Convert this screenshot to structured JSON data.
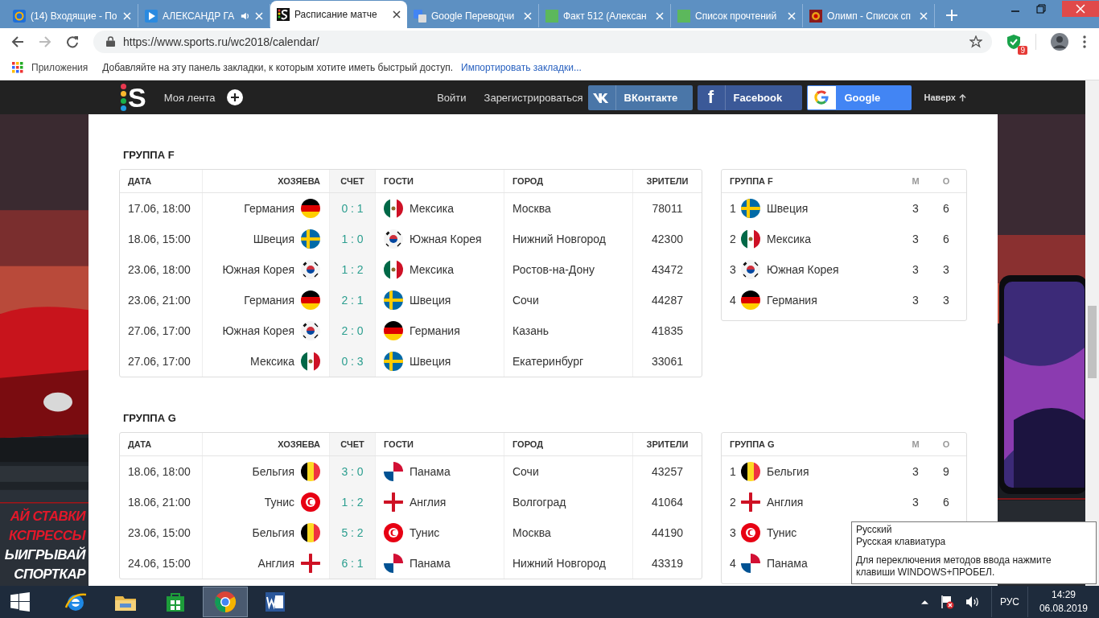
{
  "browser": {
    "tabs": [
      {
        "title": "(14) Входящие - По",
        "kind": "mail",
        "audio": false,
        "selected": false
      },
      {
        "title": "АЛЕКСАНДР ГА",
        "kind": "video",
        "audio": true,
        "selected": false
      },
      {
        "title": "Расписание матче",
        "kind": "sports",
        "audio": false,
        "selected": true
      },
      {
        "title": "Google Переводчи",
        "kind": "translate",
        "audio": false,
        "selected": false
      },
      {
        "title": "Факт 512 (Алексан",
        "kind": "sheet",
        "audio": false,
        "selected": false
      },
      {
        "title": "Список прочтений",
        "kind": "sheet",
        "audio": false,
        "selected": false
      },
      {
        "title": "Олимп - Список сп",
        "kind": "emblem",
        "audio": false,
        "selected": false
      }
    ],
    "url": "https://www.sports.ru/wc2018/calendar/",
    "extension_badge": "9",
    "bookmarks_bar": {
      "apps": "Приложения",
      "hint": "Добавляйте на эту панель закладки, к которым хотите иметь быстрый доступ.",
      "import_link": "Импортировать закладки..."
    }
  },
  "site_header": {
    "logo": "S",
    "feed": "Моя лента",
    "login": "Войти",
    "register": "Зарегистрироваться",
    "social": [
      {
        "kind": "vk",
        "label": "ВКонтакте"
      },
      {
        "kind": "facebook",
        "icon": "f",
        "label": "Facebook"
      },
      {
        "kind": "google",
        "label": "Google"
      }
    ],
    "to_top": "Наверх"
  },
  "left_ad": {
    "lines": [
      {
        "text": "АЙ СТАВКИ",
        "kind": "accent"
      },
      {
        "text": "КСПРЕССЫ",
        "kind": "accent"
      },
      {
        "text": "ЫИГРЫВАЙ",
        "kind": "plain"
      },
      {
        "text": "СПОРТКАР",
        "kind": "plain"
      }
    ]
  },
  "groups": [
    {
      "title": "ГРУППА F",
      "columns": [
        "ДАТА",
        "ХОЗЯЕВА",
        "СЧЕТ",
        "ГОСТИ",
        "ГОРОД",
        "ЗРИТЕЛИ"
      ],
      "matches": [
        {
          "date": "17.06, 18:00",
          "home": {
            "team": "Германия",
            "kind": "de"
          },
          "score": "0 : 1",
          "away": {
            "team": "Мексика",
            "kind": "mx"
          },
          "city": "Москва",
          "viewers": "78011"
        },
        {
          "date": "18.06, 15:00",
          "home": {
            "team": "Швеция",
            "kind": "se"
          },
          "score": "1 : 0",
          "away": {
            "team": "Южная Корея",
            "kind": "kr"
          },
          "city": "Нижний Новгород",
          "viewers": "42300"
        },
        {
          "date": "23.06, 18:00",
          "home": {
            "team": "Южная Корея",
            "kind": "kr"
          },
          "score": "1 : 2",
          "away": {
            "team": "Мексика",
            "kind": "mx"
          },
          "city": "Ростов-на-Дону",
          "viewers": "43472"
        },
        {
          "date": "23.06, 21:00",
          "home": {
            "team": "Германия",
            "kind": "de"
          },
          "score": "2 : 1",
          "away": {
            "team": "Швеция",
            "kind": "se"
          },
          "city": "Сочи",
          "viewers": "44287"
        },
        {
          "date": "27.06, 17:00",
          "home": {
            "team": "Южная Корея",
            "kind": "kr"
          },
          "score": "2 : 0",
          "away": {
            "team": "Германия",
            "kind": "de"
          },
          "city": "Казань",
          "viewers": "41835"
        },
        {
          "date": "27.06, 17:00",
          "home": {
            "team": "Мексика",
            "kind": "mx"
          },
          "score": "0 : 3",
          "away": {
            "team": "Швеция",
            "kind": "se"
          },
          "city": "Екатеринбург",
          "viewers": "33061"
        }
      ],
      "standings": {
        "title": "ГРУППА F",
        "columns": [
          "М",
          "О"
        ],
        "rows": [
          {
            "rank": "1",
            "kind": "se",
            "team": "Швеция",
            "m": "3",
            "o": "6"
          },
          {
            "rank": "2",
            "kind": "mx",
            "team": "Мексика",
            "m": "3",
            "o": "6"
          },
          {
            "rank": "3",
            "kind": "kr",
            "team": "Южная Корея",
            "m": "3",
            "o": "3"
          },
          {
            "rank": "4",
            "kind": "de",
            "team": "Германия",
            "m": "3",
            "o": "3"
          }
        ]
      }
    },
    {
      "title": "ГРУППА G",
      "columns": [
        "ДАТА",
        "ХОЗЯЕВА",
        "СЧЕТ",
        "ГОСТИ",
        "ГОРОД",
        "ЗРИТЕЛИ"
      ],
      "matches": [
        {
          "date": "18.06, 18:00",
          "home": {
            "team": "Бельгия",
            "kind": "be"
          },
          "score": "3 : 0",
          "away": {
            "team": "Панама",
            "kind": "pa"
          },
          "city": "Сочи",
          "viewers": "43257"
        },
        {
          "date": "18.06, 21:00",
          "home": {
            "team": "Тунис",
            "kind": "tn"
          },
          "score": "1 : 2",
          "away": {
            "team": "Англия",
            "kind": "en"
          },
          "city": "Волгоград",
          "viewers": "41064"
        },
        {
          "date": "23.06, 15:00",
          "home": {
            "team": "Бельгия",
            "kind": "be"
          },
          "score": "5 : 2",
          "away": {
            "team": "Тунис",
            "kind": "tn"
          },
          "city": "Москва",
          "viewers": "44190"
        },
        {
          "date": "24.06, 15:00",
          "home": {
            "team": "Англия",
            "kind": "en"
          },
          "score": "6 : 1",
          "away": {
            "team": "Панама",
            "kind": "pa"
          },
          "city": "Нижний Новгород",
          "viewers": "43319"
        }
      ],
      "standings": {
        "title": "ГРУППА G",
        "columns": [
          "М",
          "О"
        ],
        "rows": [
          {
            "rank": "1",
            "kind": "be",
            "team": "Бельгия",
            "m": "3",
            "o": "9"
          },
          {
            "rank": "2",
            "kind": "en",
            "team": "Англия",
            "m": "3",
            "o": "6"
          },
          {
            "rank": "3",
            "kind": "tn",
            "team": "Тунис"
          },
          {
            "rank": "4",
            "kind": "pa",
            "team": "Панама"
          }
        ]
      }
    }
  ],
  "language_tooltip": {
    "lines": [
      "Русский",
      "Русская клавиатура"
    ],
    "hint": "Для переключения методов ввода нажмите клавиши WINDOWS+ПРОБЕЛ."
  },
  "taskbar": {
    "apps": [
      {
        "kind": "ie",
        "active": false
      },
      {
        "kind": "folder",
        "active": false
      },
      {
        "kind": "store",
        "active": false
      },
      {
        "kind": "chrome",
        "active": true
      },
      {
        "kind": "word",
        "active": false
      }
    ],
    "language": "РУС",
    "time": "14:29",
    "date": "06.08.2019"
  }
}
